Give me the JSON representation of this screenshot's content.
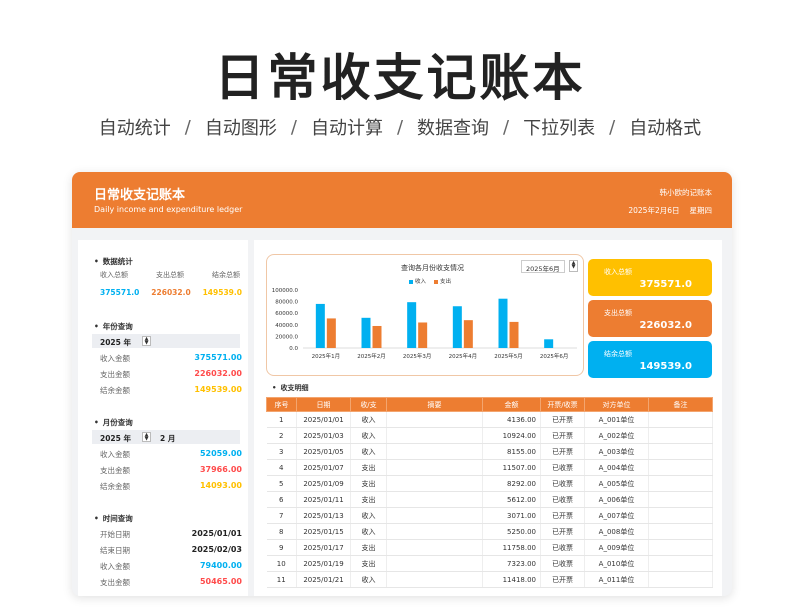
{
  "hero": {
    "title": "日常收支记账本",
    "features": [
      "自动统计",
      "自动图形",
      "自动计算",
      "数据查询",
      "下拉列表",
      "自动格式"
    ]
  },
  "colors": {
    "accent": "#ed7d31",
    "yellow": "#ffc000",
    "blue": "#00b0f0",
    "income": "#00b0f0",
    "expense": "#ed7d31",
    "balance": "#ffc000"
  },
  "header": {
    "title": "日常收支记账本",
    "subtitle": "Daily income and expenditure ledger",
    "owner": "韩小欧的记账本",
    "date": "2025年2月6日",
    "weekday": "星期四"
  },
  "left": {
    "stats": {
      "title": "数据统计",
      "labels": [
        "收入总额",
        "支出总额",
        "结余总额"
      ],
      "values": [
        "375571.0",
        "226032.0",
        "149539.0"
      ]
    },
    "year_query": {
      "title": "年份查询",
      "year": "2025 年",
      "rows": [
        {
          "label": "收入金额",
          "value": "375571.00"
        },
        {
          "label": "支出金额",
          "value": "226032.00"
        },
        {
          "label": "结余金额",
          "value": "149539.00"
        }
      ]
    },
    "month_query": {
      "title": "月份查询",
      "year": "2025 年",
      "month": "2 月",
      "rows": [
        {
          "label": "收入金额",
          "value": "52059.00"
        },
        {
          "label": "支出金额",
          "value": "37966.00"
        },
        {
          "label": "结余金额",
          "value": "14093.00"
        }
      ]
    },
    "time_query": {
      "title": "时间查询",
      "rows": [
        {
          "label": "开始日期",
          "value": "2025/01/01"
        },
        {
          "label": "结束日期",
          "value": "2025/02/03"
        },
        {
          "label": "收入金额",
          "value": "79400.00"
        },
        {
          "label": "支出金额",
          "value": "50465.00"
        }
      ]
    }
  },
  "chart": {
    "selected_month": "2025年6月",
    "spinner": "▲▼"
  },
  "chart_data": {
    "type": "bar",
    "title": "查询各月份收支情况",
    "categories": [
      "2025年1月",
      "2025年2月",
      "2025年3月",
      "2025年4月",
      "2025年5月",
      "2025年6月"
    ],
    "series": [
      {
        "name": "收入",
        "values": [
          76000,
          52059,
          79000,
          72000,
          85000,
          15000
        ]
      },
      {
        "name": "支出",
        "values": [
          51000,
          37966,
          44000,
          48000,
          45000,
          0
        ]
      }
    ],
    "ylim": [
      0,
      100000
    ],
    "yticks": [
      "100000.0",
      "80000.0",
      "60000.0",
      "40000.0",
      "20000.0",
      "0.0"
    ],
    "legend": "top",
    "grid": false
  },
  "tiles": [
    {
      "label": "收入总额",
      "value": "375571.0"
    },
    {
      "label": "支出总额",
      "value": "226032.0"
    },
    {
      "label": "结余总额",
      "value": "149539.0"
    }
  ],
  "ledger": {
    "title": "收支明细",
    "headers": [
      "序号",
      "日期",
      "收/支",
      "摘要",
      "金额",
      "开票/收票",
      "对方单位",
      "备注"
    ],
    "rows": [
      [
        "1",
        "2025/01/01",
        "收入",
        "",
        "4136.00",
        "已开票",
        "A_001单位",
        ""
      ],
      [
        "2",
        "2025/01/03",
        "收入",
        "",
        "10924.00",
        "已开票",
        "A_002单位",
        ""
      ],
      [
        "3",
        "2025/01/05",
        "收入",
        "",
        "8155.00",
        "已开票",
        "A_003单位",
        ""
      ],
      [
        "4",
        "2025/01/07",
        "支出",
        "",
        "11507.00",
        "已收票",
        "A_004单位",
        ""
      ],
      [
        "5",
        "2025/01/09",
        "支出",
        "",
        "8292.00",
        "已收票",
        "A_005单位",
        ""
      ],
      [
        "6",
        "2025/01/11",
        "支出",
        "",
        "5612.00",
        "已收票",
        "A_006单位",
        ""
      ],
      [
        "7",
        "2025/01/13",
        "收入",
        "",
        "3071.00",
        "已开票",
        "A_007单位",
        ""
      ],
      [
        "8",
        "2025/01/15",
        "收入",
        "",
        "5250.00",
        "已开票",
        "A_008单位",
        ""
      ],
      [
        "9",
        "2025/01/17",
        "支出",
        "",
        "11758.00",
        "已收票",
        "A_009单位",
        ""
      ],
      [
        "10",
        "2025/01/19",
        "支出",
        "",
        "7323.00",
        "已收票",
        "A_010单位",
        ""
      ],
      [
        "11",
        "2025/01/21",
        "收入",
        "",
        "11418.00",
        "已开票",
        "A_011单位",
        ""
      ]
    ]
  }
}
